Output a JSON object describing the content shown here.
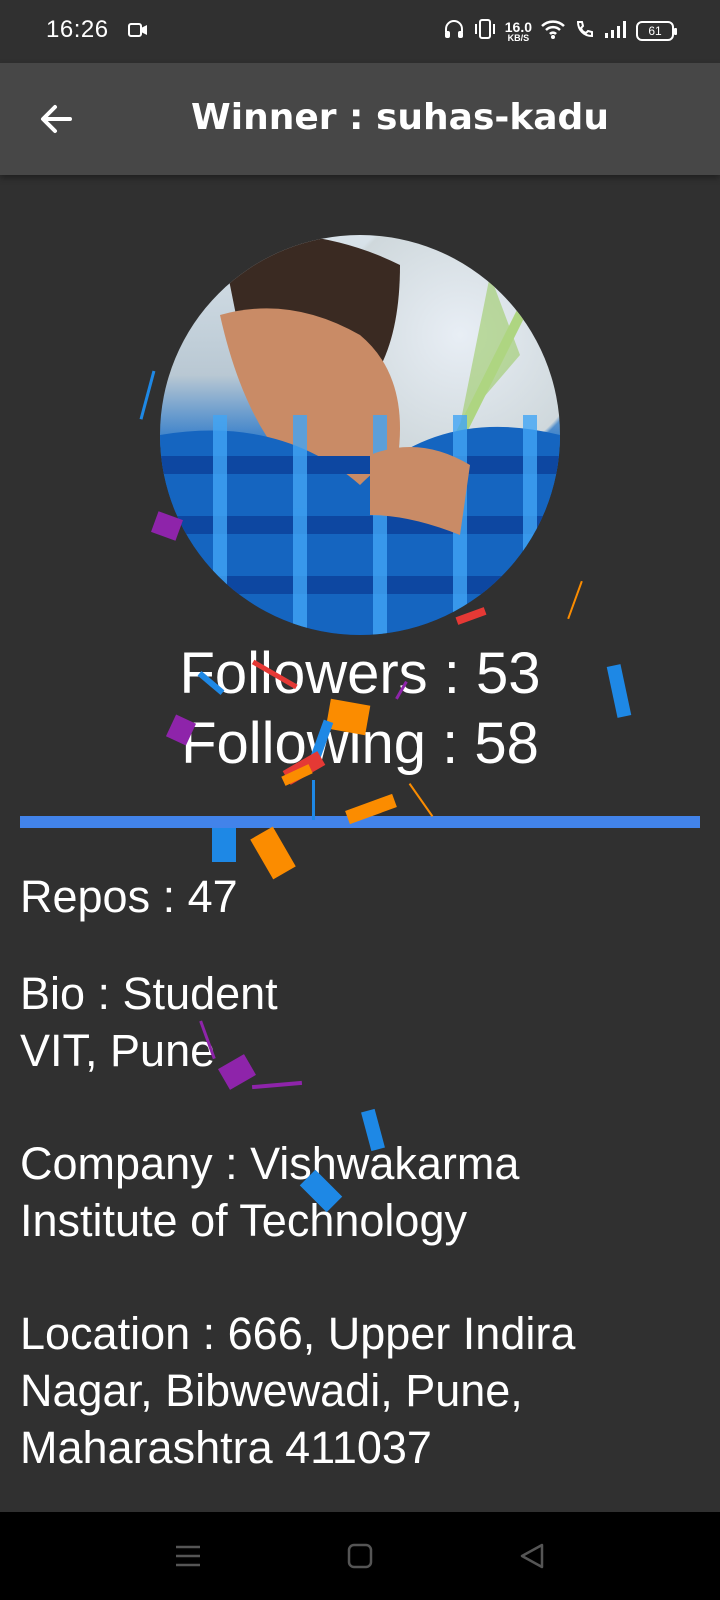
{
  "status_bar": {
    "time": "16:26",
    "speed_value": "16.0",
    "speed_unit": "KB/S",
    "battery": "61"
  },
  "app_bar": {
    "title": "Winner : suhas-kadu"
  },
  "profile": {
    "followers": "Followers : 53",
    "following": "Following : 58",
    "repos": "Repos : 47",
    "bio_line1": "Bio : Student",
    "bio_line2": "VIT, Pune",
    "company_line1": "Company : Vishwakarma",
    "company_line2": "Institute of Technology",
    "location_line1": "Location : 666, Upper Indira",
    "location_line2": "Nagar, Bibwewadi, Pune,",
    "location_line3": "Maharashtra 411037"
  },
  "colors": {
    "background": "#303030",
    "app_bar": "#474747",
    "divider": "#4283ea",
    "confetti": [
      "#1e88e5",
      "#8e24aa",
      "#fb8c00",
      "#e53935"
    ]
  }
}
